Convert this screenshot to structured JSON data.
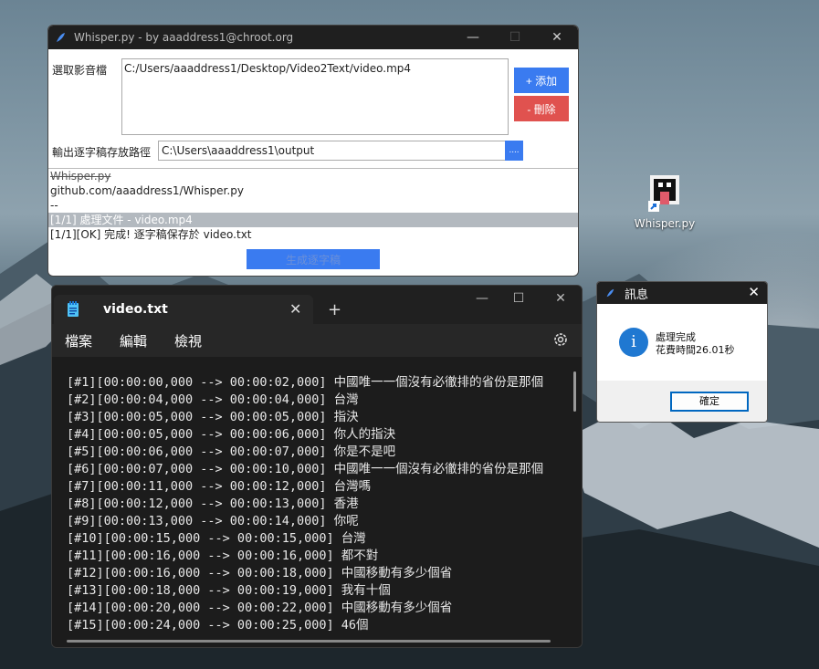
{
  "desktop": {
    "icon_label": "Whisper.py"
  },
  "whisper_window": {
    "title": "Whisper.py - by aaaddress1@chroot.org",
    "minimize": "—",
    "maximize": "☐",
    "close": "✕",
    "select_label": "選取影音檔",
    "selected_file": "C:/Users/aaaddress1/Desktop/Video2Text/video.mp4",
    "add_button": "+ 添加",
    "remove_button": "- 刪除",
    "output_label": "輸出逐字稿存放路徑",
    "output_path": "C:\\Users\\aaaddress1\\output",
    "browse_button": "....",
    "log_lines": [
      "Whisper.py",
      "github.com/aaaddress1/Whisper.py",
      " --",
      "[1/1] 處理文件 - video.mp4",
      "[1/1][OK] 完成! 逐字稿保存於 video.txt"
    ],
    "generate_button": "生成逐字稿"
  },
  "notepad": {
    "tab_title": "video.txt",
    "tab_close": "✕",
    "new_tab": "+",
    "minimize": "—",
    "maximize": "☐",
    "close": "✕",
    "menu": [
      "檔案",
      "編輯",
      "檢視"
    ],
    "lines": [
      "[#1][00:00:00,000 --> 00:00:02,000] 中國唯一一個沒有必徹排的省份是那個",
      "[#2][00:00:04,000 --> 00:00:04,000] 台灣",
      "[#3][00:00:05,000 --> 00:00:05,000] 指決",
      "[#4][00:00:05,000 --> 00:00:06,000] 你人的指決",
      "[#5][00:00:06,000 --> 00:00:07,000] 你是不是吧",
      "[#6][00:00:07,000 --> 00:00:10,000] 中國唯一一個沒有必徹排的省份是那個",
      "[#7][00:00:11,000 --> 00:00:12,000] 台灣嗎",
      "[#8][00:00:12,000 --> 00:00:13,000] 香港",
      "[#9][00:00:13,000 --> 00:00:14,000] 你呢",
      "[#10][00:00:15,000 --> 00:00:15,000] 台灣",
      "[#11][00:00:16,000 --> 00:00:16,000] 都不對",
      "[#12][00:00:16,000 --> 00:00:18,000] 中國移動有多少個省",
      "[#13][00:00:18,000 --> 00:00:19,000] 我有十個",
      "[#14][00:00:20,000 --> 00:00:22,000] 中國移動有多少個省",
      "[#15][00:00:24,000 --> 00:00:25,000] 46個"
    ]
  },
  "message_dialog": {
    "title": "訊息",
    "close": "✕",
    "info_glyph": "i",
    "line1": "處理完成",
    "line2": "花費時間26.01秒",
    "ok_button": "確定"
  },
  "colors": {
    "accent_blue": "#3a7bf0",
    "danger_red": "#e0524f",
    "notepad_bg": "#1c1c1c"
  }
}
